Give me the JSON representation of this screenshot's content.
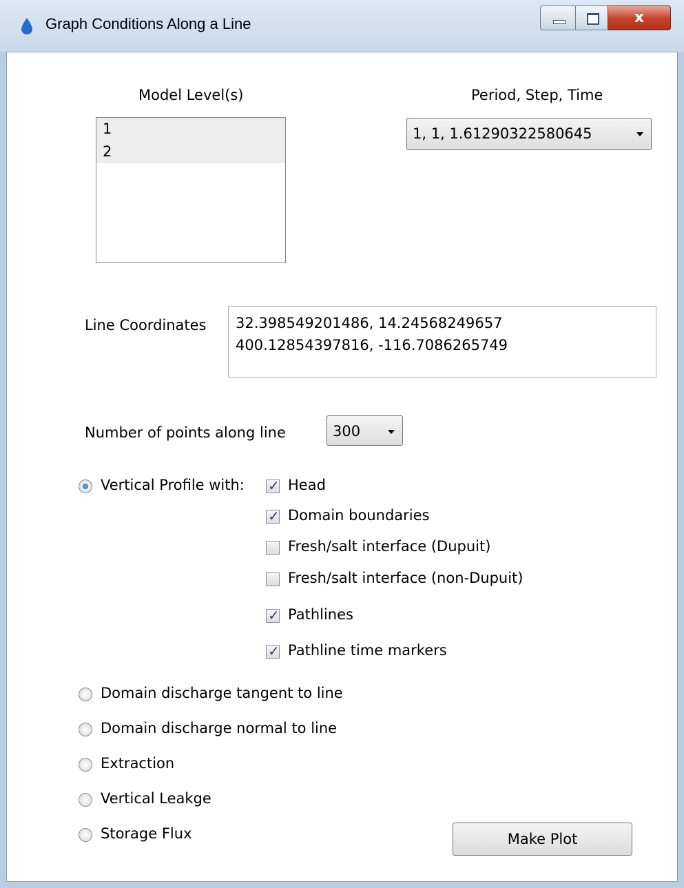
{
  "window": {
    "title": "Graph Conditions Along a Line",
    "close_glyph": "x"
  },
  "model_levels": {
    "label": "Model Level(s)",
    "items": [
      "1",
      "2"
    ]
  },
  "period_step_time": {
    "label": "Period, Step, Time",
    "selected": "1, 1, 1.61290322580645"
  },
  "line_coordinates": {
    "label": "Line Coordinates",
    "lines": [
      "32.398549201486, 14.24568249657",
      "400.12854397816, -116.7086265749"
    ]
  },
  "num_points": {
    "label": "Number of points along line",
    "selected": "300"
  },
  "plot_options": {
    "vertical_profile": {
      "label": "Vertical Profile with:",
      "selected": true,
      "checks": [
        {
          "label": "Head",
          "checked": true
        },
        {
          "label": "Domain boundaries",
          "checked": true
        },
        {
          "label": "Fresh/salt interface (Dupuit)",
          "checked": false
        },
        {
          "label": "Fresh/salt interface (non-Dupuit)",
          "checked": false
        },
        {
          "label": "Pathlines",
          "checked": true
        },
        {
          "label": "Pathline time markers",
          "checked": true
        }
      ]
    },
    "radios": [
      {
        "label": "Domain discharge tangent to line",
        "selected": false
      },
      {
        "label": "Domain discharge normal to line",
        "selected": false
      },
      {
        "label": "Extraction",
        "selected": false
      },
      {
        "label": "Vertical Leakge",
        "selected": false
      },
      {
        "label": "Storage Flux",
        "selected": false
      }
    ]
  },
  "make_plot": {
    "label": "Make Plot"
  },
  "icons": [
    "water-drop-icon",
    "minimize-icon",
    "maximize-icon",
    "close-icon",
    "chevron-down-icon"
  ],
  "colors": {
    "titlebar": "#c9d9ea",
    "close_button": "#c8462f",
    "check_mark": "#2b3f75"
  }
}
